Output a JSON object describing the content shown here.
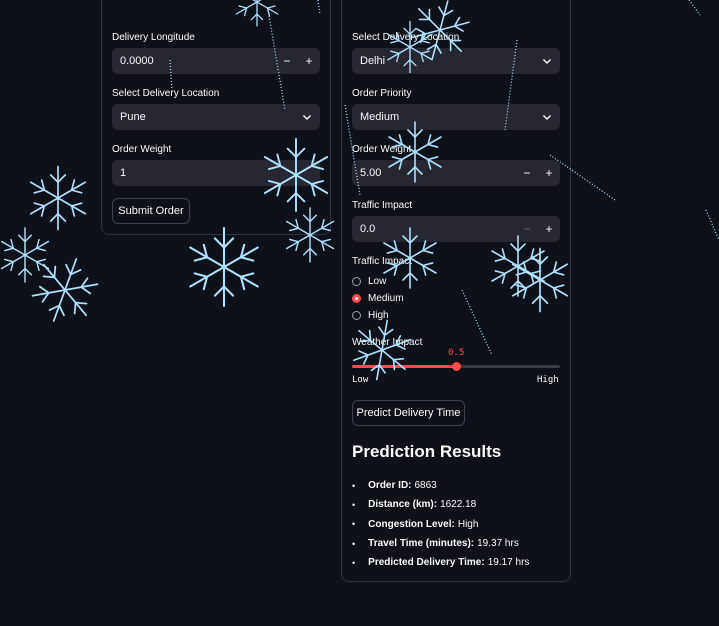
{
  "left_form": {
    "longitude": {
      "label": "Delivery Longitude",
      "value": "0.0000",
      "minus": "−",
      "plus": "+"
    },
    "location": {
      "label": "Select Delivery Location",
      "value": "Pune"
    },
    "weight": {
      "label": "Order Weight",
      "value": "1"
    },
    "submit_label": "Submit Order"
  },
  "right_form": {
    "location": {
      "label": "Select Delivery Location",
      "value": "Delhi"
    },
    "priority": {
      "label": "Order Priority",
      "value": "Medium"
    },
    "weight": {
      "label": "Order Weight",
      "value": "5.00",
      "minus": "−",
      "plus": "+"
    },
    "traffic_impact_num": {
      "label": "Traffic Impact",
      "value": "0.0",
      "minus": "−",
      "plus": "+"
    },
    "traffic_impact_radio": {
      "label": "Traffic Impact",
      "options": [
        "Low",
        "Medium",
        "High"
      ],
      "selected": "Medium"
    },
    "weather_impact": {
      "label": "Weather Impact",
      "value": "0.5",
      "fraction": 0.5,
      "min_label": "Low",
      "max_label": "High"
    },
    "predict_label": "Predict Delivery Time"
  },
  "results": {
    "heading": "Prediction Results",
    "items": [
      {
        "key": "Order ID:",
        "value": "6863"
      },
      {
        "key": "Distance (km):",
        "value": "1622.18"
      },
      {
        "key": "Congestion Level:",
        "value": "High"
      },
      {
        "key": "Travel Time (minutes):",
        "value": "19.37 hrs"
      },
      {
        "key": "Predicted Delivery Time:",
        "value": "19.17 hrs"
      }
    ]
  },
  "colors": {
    "accent": "#ff4b4b",
    "snow": "#aee0ff",
    "background": "#0e1117",
    "input": "#262730"
  }
}
